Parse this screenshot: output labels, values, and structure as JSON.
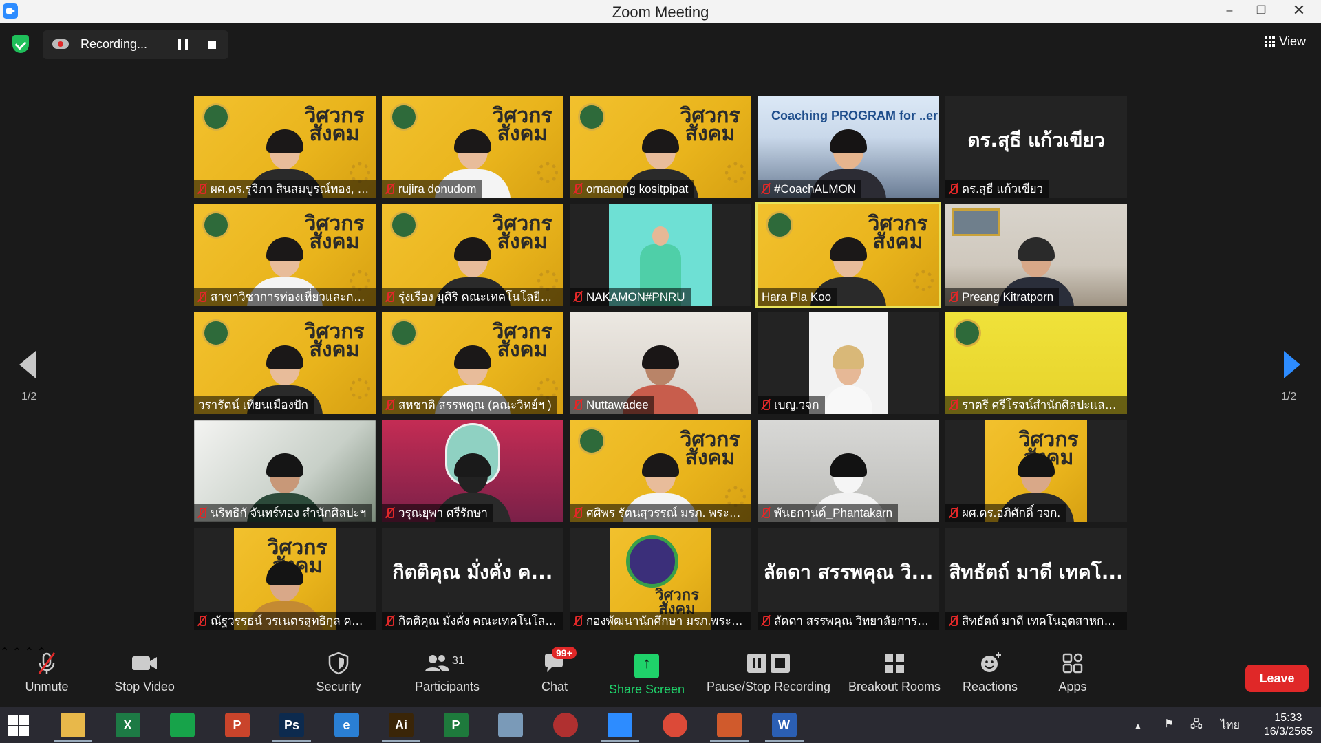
{
  "window": {
    "title": "Zoom Meeting",
    "minimize": "–",
    "restore": "❐",
    "close": "✕"
  },
  "top": {
    "recording_label": "Recording...",
    "view_label": "View"
  },
  "pager": {
    "left_page": "1/2",
    "right_page": "1/2"
  },
  "tiles": [
    {
      "label": "ผศ.ดร.รุจิภา สินสมบูรณ์ทอง, จจ...",
      "muted": true
    },
    {
      "label": "rujira donudom",
      "muted": true
    },
    {
      "label": "ornanong kositpipat",
      "muted": true
    },
    {
      "label": "#CoachALMON",
      "muted": true,
      "banner": "Coaching PROGRAM for ..er"
    },
    {
      "label": "ดร.สุธี แก้วเขียว",
      "muted": true,
      "big_name": "ดร.สุธี  แก้วเขียว"
    },
    {
      "label": "สาขาวิชาการท่องเที่ยวและการโร...",
      "muted": true
    },
    {
      "label": "รุ่งเรือง มุศิริ คณะเทคโนโลยีอุตส...",
      "muted": true
    },
    {
      "label": "NAKAMON#PNRU",
      "muted": true
    },
    {
      "label": "Hara Pla Koo",
      "muted": false
    },
    {
      "label": "Preang Kitratporn",
      "muted": true
    },
    {
      "label": "วรารัตน์ เทียนเมืองปัก",
      "muted": false
    },
    {
      "label": "สหชาติ สรรพคุณ (คณะวิทย์ฯ )",
      "muted": true
    },
    {
      "label": "Nuttawadee",
      "muted": true
    },
    {
      "label": "เบญ.วจก",
      "muted": true
    },
    {
      "label": "ราตรี   ศรีโรจน์สำนักศิลปะและวั...",
      "muted": true
    },
    {
      "label": "นริทธิกั จันทร์ทอง สำนักศิลปะฯ",
      "muted": true
    },
    {
      "label": "วรุณยุพา ศรีรักษา",
      "muted": true
    },
    {
      "label": "ศศิพร รัตนสุวรรณ์ มรภ. พระนคร",
      "muted": true
    },
    {
      "label": "พันธกานต์_Phantakarn",
      "muted": true
    },
    {
      "label": "ผศ.ดร.อภิศักดิ์ วจก.",
      "muted": true
    },
    {
      "label": "ณัฐวรรธน์ วรเนตรสุทธิกุล คณะเ...",
      "muted": true
    },
    {
      "label": "กิตติคุณ  มั่งคั่ง คณะเทคโนโลยีอุ...",
      "muted": true,
      "big_name": "กิตติคุณ  มั่งคั่ง  ค..."
    },
    {
      "label": "กองพัฒนานักศึกษา มรภ.พระนคร",
      "muted": true
    },
    {
      "label": "ลัดดา สรรพคุณ วิทยาลัยการฝี...",
      "muted": true,
      "big_name": "ลัดดา  สรรพคุณ  วิ..."
    },
    {
      "label": "สิทธัตถ์ มาดี เทคโนอุตสาหกรรม",
      "muted": true,
      "big_name": "สิทธัตถ์  มาดี  เทคโ..."
    }
  ],
  "logo_text": "วิศวกร\nสังคม",
  "toolbar": {
    "unmute": "Unmute",
    "stop_video": "Stop Video",
    "security": "Security",
    "participants": "Participants",
    "participants_count": "31",
    "chat": "Chat",
    "chat_badge": "99+",
    "share_screen": "Share Screen",
    "pause_stop_recording": "Pause/Stop Recording",
    "breakout_rooms": "Breakout Rooms",
    "reactions": "Reactions",
    "apps": "Apps",
    "leave": "Leave"
  },
  "taskbar": {
    "apps": [
      {
        "name": "file-explorer",
        "glyph": "",
        "color": "#e8b84a"
      },
      {
        "name": "excel",
        "glyph": "X",
        "color": "#1d7a45"
      },
      {
        "name": "publisher-store",
        "glyph": "",
        "color": "#17a34a"
      },
      {
        "name": "powerpoint",
        "glyph": "P",
        "color": "#c9442b"
      },
      {
        "name": "photoshop",
        "glyph": "Ps",
        "color": "#0c2a4e"
      },
      {
        "name": "internet-explorer",
        "glyph": "e",
        "color": "#2a7fd4"
      },
      {
        "name": "illustrator",
        "glyph": "Ai",
        "color": "#3a2508"
      },
      {
        "name": "project",
        "glyph": "P",
        "color": "#1e7a3c"
      },
      {
        "name": "notes",
        "glyph": "",
        "color": "#7a9ab8"
      },
      {
        "name": "photoscape",
        "glyph": "",
        "color": "#b03030"
      },
      {
        "name": "zoom",
        "glyph": "",
        "color": "#2d8cff"
      },
      {
        "name": "chrome",
        "glyph": "",
        "color": "#dc4a38"
      },
      {
        "name": "powerpoint-show",
        "glyph": "",
        "color": "#d05a2c"
      },
      {
        "name": "word",
        "glyph": "W",
        "color": "#2b5fb4"
      }
    ],
    "language": "ไทย",
    "time": "15:33",
    "date": "16/3/2565",
    "tray_arrow": "▲"
  }
}
